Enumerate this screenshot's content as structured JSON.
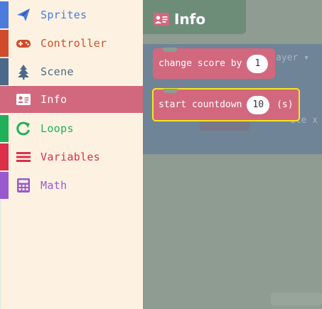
{
  "toolbox": {
    "categories": [
      {
        "label": "Sprites",
        "icon": "paper-plane-icon",
        "color": "#4b7bdc"
      },
      {
        "label": "Controller",
        "icon": "gamepad-icon",
        "color": "#d14b2b"
      },
      {
        "label": "Scene",
        "icon": "tree-icon",
        "color": "#4b6a8a"
      },
      {
        "label": "Info",
        "icon": "id-card-icon",
        "color": "#d2687e",
        "selected": true
      },
      {
        "label": "Loops",
        "icon": "refresh-icon",
        "color": "#20b05a"
      },
      {
        "label": "Variables",
        "icon": "list-icon",
        "color": "#dc2f4a"
      },
      {
        "label": "Math",
        "icon": "calculator-icon",
        "color": "#9b59d0"
      }
    ]
  },
  "flyout": {
    "title": "Info",
    "blocks": [
      {
        "prefix": "change score by",
        "value": "1",
        "suffix": ""
      },
      {
        "prefix": "start countdown",
        "value": "10",
        "suffix": "(s)"
      }
    ]
  },
  "workspace": {
    "background_text_a": "ayer ▾",
    "background_text_b": "ite x"
  }
}
